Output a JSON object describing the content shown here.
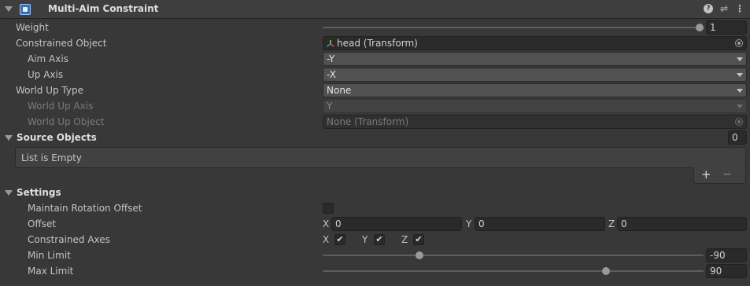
{
  "component": {
    "title": "Multi-Aim Constraint",
    "help_icon": "?",
    "preset_icon": "⇌",
    "menu_icon": "⋮"
  },
  "properties": {
    "weight": {
      "label": "Weight",
      "value": "1"
    },
    "constrained_object": {
      "label": "Constrained Object",
      "value": "head (Transform)"
    },
    "aim_axis": {
      "label": "Aim Axis",
      "value": "-Y"
    },
    "up_axis": {
      "label": "Up Axis",
      "value": "-X"
    },
    "world_up_type": {
      "label": "World Up Type",
      "value": "None"
    },
    "world_up_axis": {
      "label": "World Up Axis",
      "value": "Y"
    },
    "world_up_object": {
      "label": "World Up Object",
      "value": "None (Transform)"
    }
  },
  "source_objects": {
    "label": "Source Objects",
    "count": "0",
    "empty_text": "List is Empty",
    "add": "+",
    "remove": "−"
  },
  "settings": {
    "label": "Settings",
    "maintain_offset": {
      "label": "Maintain Rotation Offset",
      "checked": false
    },
    "offset": {
      "label": "Offset",
      "x_label": "X",
      "x": "0",
      "y_label": "Y",
      "y": "0",
      "z_label": "Z",
      "z": "0"
    },
    "constrained_axes": {
      "label": "Constrained Axes",
      "x_label": "X",
      "y_label": "Y",
      "z_label": "Z",
      "x": true,
      "y": true,
      "z": true,
      "check": "✔"
    },
    "min_limit": {
      "label": "Min Limit",
      "value": "-90"
    },
    "max_limit": {
      "label": "Max Limit",
      "value": "90"
    }
  },
  "colors": {
    "background": "#383838",
    "field": "#2a2a2a",
    "dropdown": "#515151",
    "text": "#c4c4c4",
    "disabled_text": "#7a7a7a"
  }
}
